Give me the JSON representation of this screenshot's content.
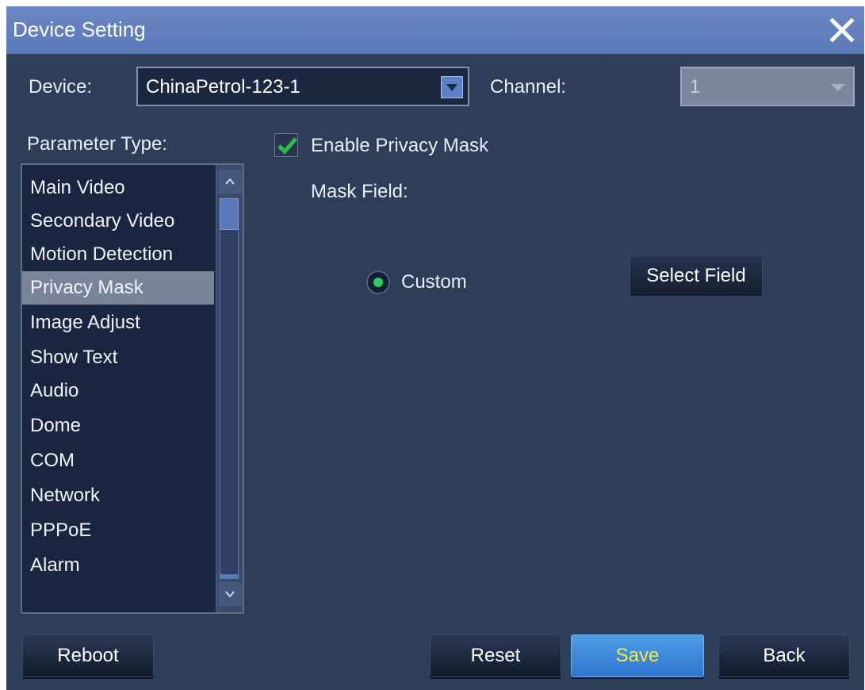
{
  "window": {
    "title": "Device Setting",
    "close_icon": "close-icon"
  },
  "device": {
    "label": "Device:",
    "value": "ChinaPetrol-123-1"
  },
  "channel": {
    "label": "Channel:",
    "value": "1"
  },
  "parameter_type": {
    "label": "Parameter Type:",
    "items": [
      "Main Video",
      "Secondary Video",
      "Motion Detection",
      "Privacy Mask",
      "Image Adjust",
      "Show Text",
      "Audio",
      "Dome",
      "COM",
      "Network",
      "PPPoE",
      "Alarm"
    ],
    "selected": "Privacy Mask"
  },
  "privacy": {
    "enable_label": "Enable Privacy Mask",
    "enabled": true,
    "mask_field_label": "Mask Field:",
    "custom_label": "Custom",
    "select_field_label": "Select Field"
  },
  "buttons": {
    "reboot": "Reboot",
    "reset": "Reset",
    "save": "Save",
    "back": "Back"
  },
  "colors": {
    "accent": "#5a78b8",
    "save_text": "#f4ee3a",
    "radio_on": "#27d25a",
    "check": "#27c24c"
  }
}
